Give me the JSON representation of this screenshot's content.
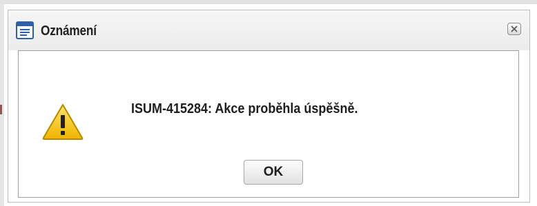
{
  "dialog": {
    "title": "Oznámení",
    "title_icon": "notification-window-icon",
    "close_icon": "close-icon",
    "message": "ISUM-415284: Akce proběhla úspěšně.",
    "message_icon": "warning-icon",
    "ok_label": "OK"
  },
  "colors": {
    "warning_fill": "#f5c400",
    "title_icon_blue": "#2f5fa8",
    "text": "#1e1e1e"
  }
}
